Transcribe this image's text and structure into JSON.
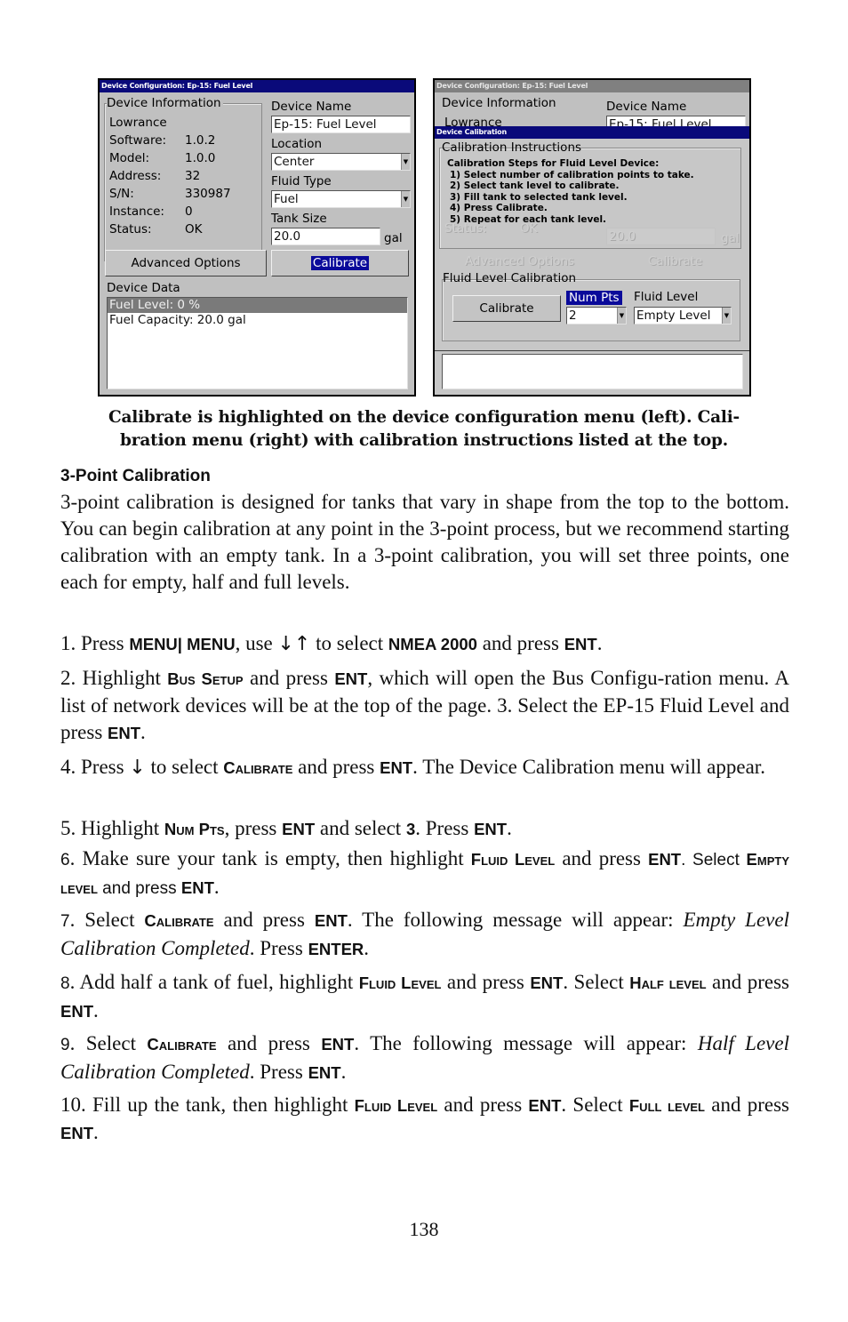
{
  "left_screen": {
    "title": "Device Configuration: Ep-15: Fuel Level",
    "device_info": {
      "label": "Device Information",
      "manufacturer": "Lowrance",
      "rows": [
        {
          "key": "Software:",
          "value": "1.0.2"
        },
        {
          "key": "Model:",
          "value": "1.0.0"
        },
        {
          "key": "Address:",
          "value": "32"
        },
        {
          "key": "S/N:",
          "value": "330987"
        },
        {
          "key": "Instance:",
          "value": "0"
        },
        {
          "key": "Status:",
          "value": "OK"
        }
      ]
    },
    "device_name": {
      "label": "Device Name",
      "value": "Ep-15: Fuel Level"
    },
    "location": {
      "label": "Location",
      "value": "Center"
    },
    "fluid_type": {
      "label": "Fluid Type",
      "value": "Fuel"
    },
    "tank_size": {
      "label": "Tank Size",
      "value": "20.0",
      "unit": "gal"
    },
    "advanced_options_button": "Advanced Options",
    "calibrate_button": "Calibrate",
    "device_data": {
      "label": "Device Data",
      "rows": [
        "Fuel Level: 0 %",
        "Fuel Capacity: 20.0 gal"
      ]
    }
  },
  "right_screen": {
    "background_title": "Device Configuration: Ep-15: Fuel Level",
    "background_device_info_label": "Device Information",
    "background_manufacturer": "Lowrance",
    "background_device_name_label": "Device Name",
    "background_device_name_value": "Ep-15: Fuel Level",
    "background_tank_size": "20.0",
    "background_unit": "gal",
    "background_status_key": "Status:",
    "background_status_value": "OK",
    "background_advanced": "Advanced Options",
    "background_calibrate": "Calibrate",
    "dialog_title": "Device Calibration",
    "instructions": {
      "label": "Calibration Instructions",
      "heading": "Calibration Steps for Fluid Level Device:",
      "steps": [
        "1) Select number of calibration points to take.",
        "2) Select tank level to calibrate.",
        "3) Fill tank to selected tank level.",
        "4) Press Calibrate.",
        "5) Repeat for each tank level."
      ]
    },
    "fluid_level_calibration": {
      "label": "Fluid Level Calibration",
      "calibrate_button": "Calibrate",
      "num_pts": {
        "label": "Num Pts",
        "value": "2"
      },
      "fluid_level": {
        "label": "Fluid Level",
        "value": "Empty Level"
      }
    }
  },
  "caption": {
    "line1": "Calibrate is highlighted on the device configuration menu (left).  Cali-",
    "line2": "bration menu (right) with calibration instructions listed at the top."
  },
  "section_heading": "3-Point Calibration",
  "intro": "3-point calibration is designed for tanks that vary in shape from the top to the bottom. You can begin calibration at any point in the 3-point process, but we recommend starting calibration with an empty tank. In a 3-point calibration, you will set three points, one each for empty, half and full levels.",
  "steps": {
    "s1": {
      "a": "1. Press ",
      "k1": "MENU| MENU",
      "b": ", use ",
      "arrows": "↓↑",
      "c": " to select ",
      "k2": "NMEA 2000",
      "d": " and press ",
      "k3": "ENT",
      "e": "."
    },
    "s2": {
      "a": "2. Highlight ",
      "sc1": "Bus Setup",
      "b": " and press ",
      "k1": "ENT",
      "c": ", which will open the Bus Configu-ration menu. A list of network devices will be at the top of the page. 3. Select the EP-15 Fluid Level and press ",
      "k2": "ENT",
      "d": "."
    },
    "s4": {
      "a": "4. Press ",
      "arrow": "↓",
      "b": " to select ",
      "sc1": "Calibrate",
      "c": " and press ",
      "k1": "ENT",
      "d": ". The Device Calibration menu will appear."
    },
    "s5": {
      "a": "5. Highlight ",
      "sc1": "Num Pts",
      "b": ", press ",
      "k1": "ENT",
      "c": " and select ",
      "k2": "3",
      "d": ". Press ",
      "k3": "ENT",
      "e": "."
    },
    "s6": {
      "num": "6",
      "a": ". Make sure your tank is empty, then highlight ",
      "sc1": "Fluid Level",
      "b": " and press ",
      "k1": "ENT",
      "c": ". Select ",
      "sc2": "Empty level",
      "d": " and press ",
      "k2": "ENT",
      "e": "."
    },
    "s7": {
      "num": "7",
      "a": ". Select ",
      "sc1": "Calibrate",
      "b": " and press ",
      "k1": "ENT",
      "c": ". The following message will appear: ",
      "i": "Empty Level Calibration Completed",
      "d": ". Press ",
      "k2": "ENTER",
      "e": "."
    },
    "s8": {
      "num": "8",
      "a": ". Add half a tank of fuel, highlight ",
      "sc1": "Fluid Level",
      "b": " and press ",
      "k1": "ENT",
      "c": ". Select ",
      "sc2": "Half level",
      "d": " and press ",
      "k2": "ENT",
      "e": "."
    },
    "s9": {
      "num": "9",
      "a": ". Select ",
      "sc1": "Calibrate",
      "b": " and press ",
      "k1": "ENT",
      "c": ". The following message will appear: ",
      "i": "Half Level Calibration Completed",
      "d": ". Press ",
      "k2": "ENT",
      "e": "."
    },
    "s10": {
      "a": "10. Fill up the tank, then highlight ",
      "sc1": "Fluid Level",
      "b": " and press ",
      "k1": "ENT",
      "c": ". Select ",
      "sc2": "Full level",
      "d": " and press ",
      "k2": "ENT",
      "e": "."
    }
  },
  "page_number": "138"
}
